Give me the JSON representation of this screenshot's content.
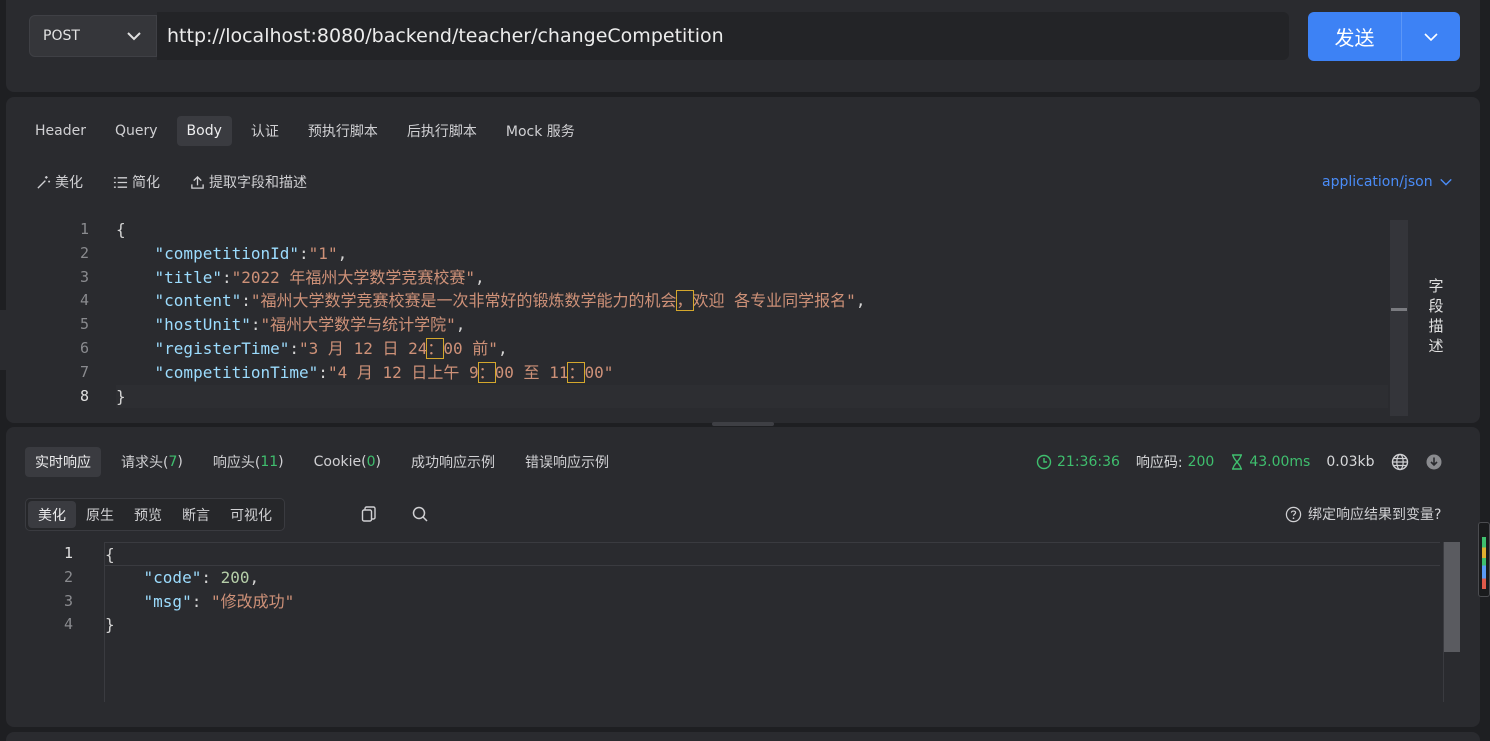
{
  "request": {
    "method": "POST",
    "url": "http://localhost:8080/backend/teacher/changeCompetition",
    "send_label": "发送"
  },
  "req_tabs": [
    "Header",
    "Query",
    "Body",
    "认证",
    "预执行脚本",
    "后执行脚本",
    "Mock 服务"
  ],
  "req_active_tab": "Body",
  "body_tools": {
    "beautify": "美化",
    "simplify": "简化",
    "extract": "提取字段和描述",
    "content_type": "application/json"
  },
  "body_lines": [
    "1",
    "2",
    "3",
    "4",
    "5",
    "6",
    "7",
    "8"
  ],
  "body": {
    "open": "{",
    "close": "}",
    "k1": "\"competitionId\"",
    "v1": "\"1\"",
    "k2": "\"title\"",
    "v2": "\"2022 年福州大学数学竞赛校赛\"",
    "k3": "\"content\"",
    "v3a": "\"福州大学数学竞赛校赛是一次非常好的锻炼数学能力的机会",
    "v3b": "，",
    "v3c": "欢迎 各专业同学报名\"",
    "k4": "\"hostUnit\"",
    "v4": "\"福州大学数学与统计学院\"",
    "k5": "\"registerTime\"",
    "v5a": "\"3 月 12 日 24",
    "v5b": "：",
    "v5c": "00 前\"",
    "k6": "\"competitionTime\"",
    "v6a": "\"4 月 12 日上午 9",
    "v6b": "：",
    "v6c": "00 至 11",
    "v6d": "：",
    "v6e": "00\""
  },
  "side_desc": "字段描述",
  "res_tabs": {
    "realtime": "实时响应",
    "req_headers": "请求头(",
    "req_headers_count": "7",
    "res_headers": "响应头(",
    "res_headers_count": "11",
    "cookie": "Cookie(",
    "cookie_count": "0",
    "close_paren": ")",
    "success_example": "成功响应示例",
    "error_example": "错误响应示例"
  },
  "res_meta": {
    "time": "21:36:36",
    "code_label": "响应码:",
    "code": "200",
    "duration": "43.00ms",
    "size": "0.03kb"
  },
  "view_modes": [
    "美化",
    "原生",
    "预览",
    "断言",
    "可视化"
  ],
  "view_active": "美化",
  "bind_var_label": "绑定响应结果到变量?",
  "res_lines": [
    "1",
    "2",
    "3",
    "4"
  ],
  "res_body": {
    "open": "{",
    "close": "}",
    "k1": "\"code\"",
    "v1": "200",
    "k2": "\"msg\"",
    "v2": "\"修改成功\""
  }
}
